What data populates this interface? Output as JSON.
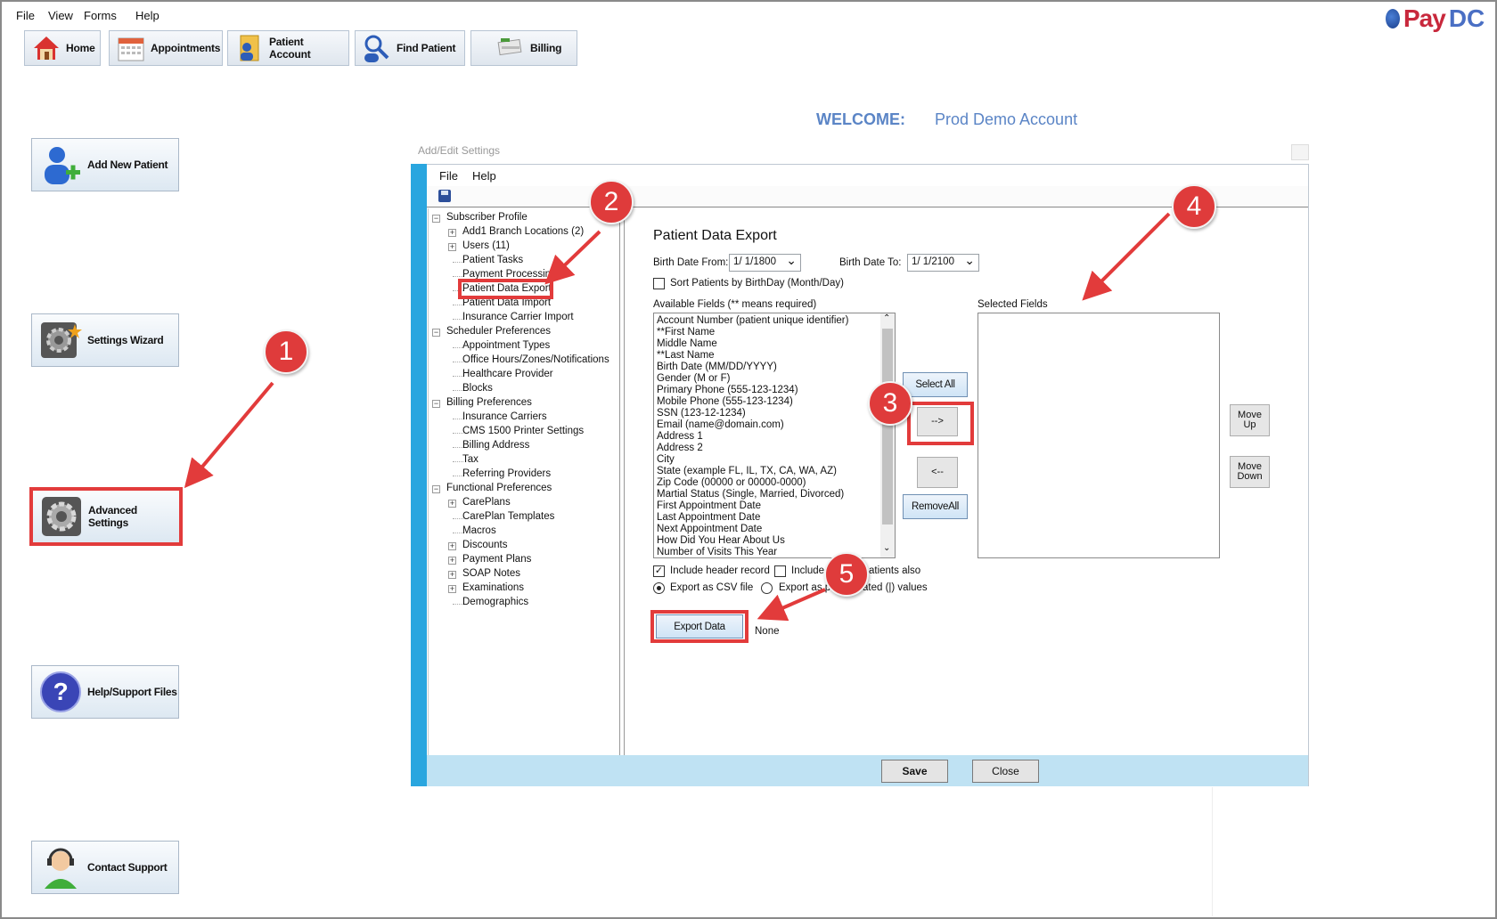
{
  "menu": [
    "File",
    "View",
    "Forms",
    "Help"
  ],
  "logo": {
    "pay": "Pay",
    "dc": "DC"
  },
  "nav": [
    {
      "label": "Home",
      "icon": "home-icon"
    },
    {
      "label": "Appointments",
      "icon": "calendar-icon"
    },
    {
      "label": "Patient Account",
      "icon": "patient-account-icon"
    },
    {
      "label": "Find Patient",
      "icon": "find-patient-icon"
    },
    {
      "label": "Billing",
      "icon": "billing-icon"
    }
  ],
  "left_buttons": [
    {
      "label": "Add New Patient",
      "icon": "add-user-icon"
    },
    {
      "label": "Settings Wizard",
      "icon": "wizard-gear-icon"
    },
    {
      "label": "Advanced Settings",
      "icon": "gear-icon"
    },
    {
      "label": "Help/Support Files",
      "icon": "question-icon"
    },
    {
      "label": "Contact Support",
      "icon": "headset-icon"
    }
  ],
  "welcome": {
    "label": "WELCOME:",
    "account": "Prod Demo Account"
  },
  "dialog": {
    "title": "Add/Edit Settings",
    "menu": [
      "File",
      "Help"
    ],
    "tree": [
      {
        "label": "Subscriber Profile",
        "level": 0,
        "toggle": "-"
      },
      {
        "label": "Add1 Branch Locations (2)",
        "level": 1,
        "toggle": "+"
      },
      {
        "label": "Users (11)",
        "level": 1,
        "toggle": "+"
      },
      {
        "label": "Patient Tasks",
        "level": 1
      },
      {
        "label": "Payment Processing",
        "level": 1
      },
      {
        "label": "Patient Data Export",
        "level": 1,
        "selected": true
      },
      {
        "label": "Patient Data Import",
        "level": 1
      },
      {
        "label": "Insurance Carrier Import",
        "level": 1
      },
      {
        "label": "Scheduler Preferences",
        "level": 0,
        "toggle": "-"
      },
      {
        "label": "Appointment Types",
        "level": 1
      },
      {
        "label": "Office Hours/Zones/Notifications",
        "level": 1
      },
      {
        "label": "Healthcare Provider",
        "level": 1
      },
      {
        "label": "Blocks",
        "level": 1
      },
      {
        "label": "Billing Preferences",
        "level": 0,
        "toggle": "-"
      },
      {
        "label": "Insurance Carriers",
        "level": 1
      },
      {
        "label": "CMS 1500 Printer Settings",
        "level": 1
      },
      {
        "label": "Billing Address",
        "level": 1
      },
      {
        "label": "Tax",
        "level": 1
      },
      {
        "label": "Referring Providers",
        "level": 1
      },
      {
        "label": "Functional Preferences",
        "level": 0,
        "toggle": "-"
      },
      {
        "label": "CarePlans",
        "level": 1,
        "toggle": "+"
      },
      {
        "label": "CarePlan Templates",
        "level": 1
      },
      {
        "label": "Macros",
        "level": 1
      },
      {
        "label": "Discounts",
        "level": 1,
        "toggle": "+"
      },
      {
        "label": "Payment Plans",
        "level": 1,
        "toggle": "+"
      },
      {
        "label": "SOAP Notes",
        "level": 1,
        "toggle": "+"
      },
      {
        "label": "Examinations",
        "level": 1,
        "toggle": "+"
      },
      {
        "label": "Demographics",
        "level": 1
      }
    ],
    "export": {
      "heading": "Patient Data Export",
      "birth_from_label": "Birth Date From:",
      "birth_from": "1/ 1/1800",
      "birth_to_label": "Birth Date To:",
      "birth_to": "1/ 1/2100",
      "sort_label": "Sort Patients by BirthDay (Month/Day)",
      "available_label": "Available Fields (** means required)",
      "selected_label": "Selected Fields",
      "available": [
        "Account Number (patient unique identifier)",
        "**First Name",
        "Middle Name",
        "**Last Name",
        "Birth Date (MM/DD/YYYY)",
        "Gender (M or F)",
        "Primary Phone (555-123-1234)",
        "Mobile Phone (555-123-1234)",
        "SSN (123-12-1234)",
        "Email (name@domain.com)",
        "Address 1",
        "Address 2",
        "City",
        "State (example FL, IL, TX, CA, WA, AZ)",
        "Zip Code (00000 or 00000-0000)",
        "Martial Status (Single, Married, Divorced)",
        "First Appointment Date",
        "Last Appointment Date",
        "Next Appointment Date",
        "How Did You Hear About Us",
        "Number of Visits This Year"
      ],
      "select_all": "Select All",
      "add": "-->",
      "remove": "<--",
      "remove_all": "RemoveAll",
      "move_up": "Move Up",
      "move_down": "Move Down",
      "include_header": "Include header record",
      "include_inactive_a": "Include",
      "include_inactive_b": "atients also",
      "export_csv": "Export as CSV file",
      "export_pipe_a": "Export as p",
      "export_pipe_b": "ated (|) values",
      "export_button": "Export Data",
      "status": "None"
    },
    "save": "Save",
    "close": "Close"
  },
  "annotations": [
    "1",
    "2",
    "3",
    "4",
    "5"
  ],
  "colors": {
    "accent_red": "#e23b3b",
    "dialog_blue": "#2aa6df",
    "welcome_blue": "#5b85c6",
    "footer_blue": "#bfe2f3"
  }
}
